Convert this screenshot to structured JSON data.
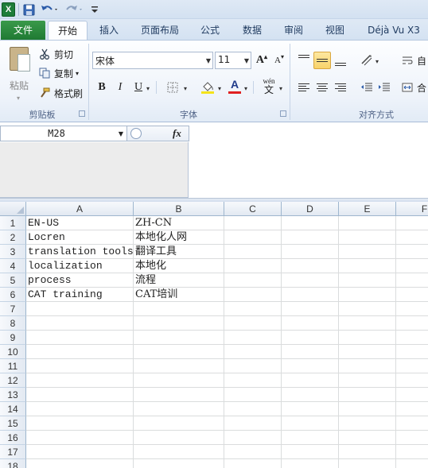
{
  "app": {
    "logo_letter": "X"
  },
  "qat": {
    "icons": [
      "excel-logo-icon",
      "save-icon",
      "undo-icon",
      "redo-icon",
      "customize-qat-icon"
    ]
  },
  "tabs": {
    "file": "文件",
    "home": "开始",
    "insert": "插入",
    "page_layout": "页面布局",
    "formulas": "公式",
    "data": "数据",
    "review": "审阅",
    "view": "视图",
    "deja_vu": "Déjà Vu X3"
  },
  "ribbon": {
    "clipboard": {
      "paste": "粘贴",
      "cut": "剪切",
      "copy": "复制",
      "format_painter": "格式刷",
      "group_label": "剪贴板"
    },
    "font": {
      "font_name": "宋体",
      "font_size": "11",
      "bold": "B",
      "italic": "I",
      "underline": "U",
      "font_color_letter": "A",
      "grow_letter": "A",
      "shrink_letter": "A",
      "phonetic": "wén",
      "group_label": "字体",
      "fill_color": "#f5e31a",
      "font_color": "#e02020"
    },
    "alignment": {
      "group_label": "对齐方式",
      "wrap_text_partial": "自",
      "merge_partial": "合"
    }
  },
  "formula_bar": {
    "name_box": "M28",
    "fx": "fx",
    "formula": ""
  },
  "grid": {
    "columns": [
      "A",
      "B",
      "C",
      "D",
      "E",
      "F"
    ],
    "rows": [
      "1",
      "2",
      "3",
      "4",
      "5",
      "6",
      "7",
      "8",
      "9",
      "10",
      "11",
      "12",
      "13",
      "14",
      "15",
      "16",
      "17",
      "18"
    ],
    "cells": [
      {
        "A": "EN-US",
        "B": "ZH-CN"
      },
      {
        "A": "Locren",
        "B": "本地化人网"
      },
      {
        "A": "translation tools",
        "B": "翻译工具"
      },
      {
        "A": "localization",
        "B": "本地化"
      },
      {
        "A": "process",
        "B": "流程"
      },
      {
        "A": "CAT training",
        "B": "CAT培训"
      }
    ]
  }
}
